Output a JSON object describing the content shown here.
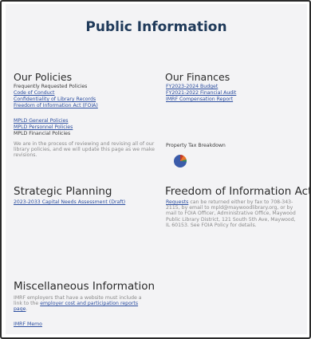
{
  "page": {
    "title": "Public Information"
  },
  "policies": {
    "heading": "Our Policies",
    "subheading": "Frequently Requested Policies",
    "links": [
      "Code of Conduct",
      "Confidentiality of Library Records",
      "Freedom of Information Act (FOIA)"
    ],
    "mpld_links": [
      "MPLD General Policies",
      "MPLD Personnel Policies"
    ],
    "mpld_plain": "MPLD Financial Policies",
    "note_lines": [
      "We are in the process of reviewing and revising all of our",
      "library policies, and we will update this page as we make",
      "revisions."
    ]
  },
  "finances": {
    "heading": "Our Finances",
    "links": [
      "FY2023-2024 Budget",
      "FY2021-2022 Financial Audit",
      "IMRF Compensation Report"
    ],
    "tax_label": "Property Tax Breakdown",
    "pie_colors": [
      "#c0392b",
      "#e8742a",
      "#2e8b57",
      "#3b5ba9"
    ]
  },
  "planning": {
    "heading": "Strategic Planning",
    "link": "2023-2033 Capital Needs Assessment (Draft)"
  },
  "foia": {
    "heading": "Freedom of Information Act",
    "link": "Requests",
    "lines": [
      " can be returned either by fax to 708-343-",
      "2115, by email to mpld@maywoodlibrary.org, or by",
      "mail to FOIA Officer, Administrative Office, Maywood",
      "Public Library District, 121 South 5th Ave, Maywood,",
      "IL 60153. See FOIA Policy for details."
    ]
  },
  "misc": {
    "heading": "Miscellaneous Information",
    "line1": "IMRF employers that have a website must include a",
    "line2_text": "link to the ",
    "line2_link": "employer cost and participation reports",
    "line3_link": "page",
    "line3_text": ".",
    "memo_link": "IMRF Memo"
  }
}
